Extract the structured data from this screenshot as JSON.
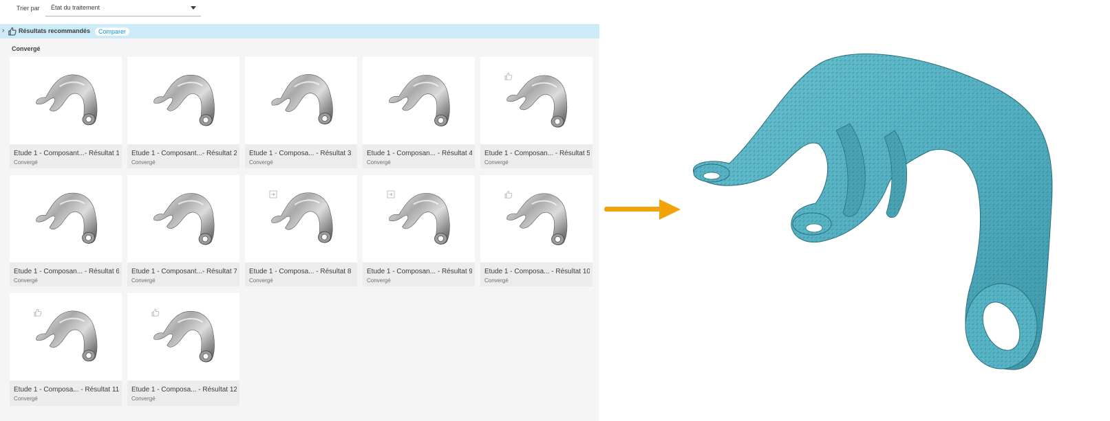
{
  "sort": {
    "label": "Trier par",
    "value": "État du traitement"
  },
  "recommended": {
    "label": "Résultats recommandés",
    "compare_label": "Comparer",
    "icon": "thumbs-up-icon"
  },
  "group": {
    "label": "Convergé"
  },
  "cards": [
    {
      "title": "Étude 1 - Composant...- Résultat 1",
      "status": "Convergé",
      "badge": ""
    },
    {
      "title": "Étude 1 - Composant...- Résultat 2",
      "status": "Convergé",
      "badge": ""
    },
    {
      "title": "Étude 1 - Composa... - Résultat 3",
      "status": "Convergé",
      "badge": ""
    },
    {
      "title": "Étude 1 - Composan... - Résultat 4",
      "status": "Convergé",
      "badge": ""
    },
    {
      "title": "Étude 1 - Composan... - Résultat 5",
      "status": "Convergé",
      "badge": "thumbs-up-icon"
    },
    {
      "title": "Étude 1 - Composan... - Résultat 6",
      "status": "Convergé",
      "badge": ""
    },
    {
      "title": "Étude 1 - Composant...- Résultat 7",
      "status": "Convergé",
      "badge": ""
    },
    {
      "title": "Étude 1 - Composa... - Résultat 8",
      "status": "Convergé",
      "badge": "export-icon"
    },
    {
      "title": "Étude 1 - Composan... - Résultat 9",
      "status": "Convergé",
      "badge": "export-icon"
    },
    {
      "title": "Étude 1 - Composa... - Résultat 10",
      "status": "Convergé",
      "badge": "thumbs-up-icon"
    },
    {
      "title": "Étude 1 - Composa... - Résultat 11",
      "status": "Convergé",
      "badge": "thumbs-up-icon"
    },
    {
      "title": "Étude 1 - Composa... - Résultat 12",
      "status": "Convergé",
      "badge": "thumbs-up-icon"
    }
  ],
  "colors": {
    "accent": "#0696d7",
    "recommended_bar": "#cdeaf9",
    "arrow": "#f0a30a",
    "mesh": "#5ab9c9"
  }
}
